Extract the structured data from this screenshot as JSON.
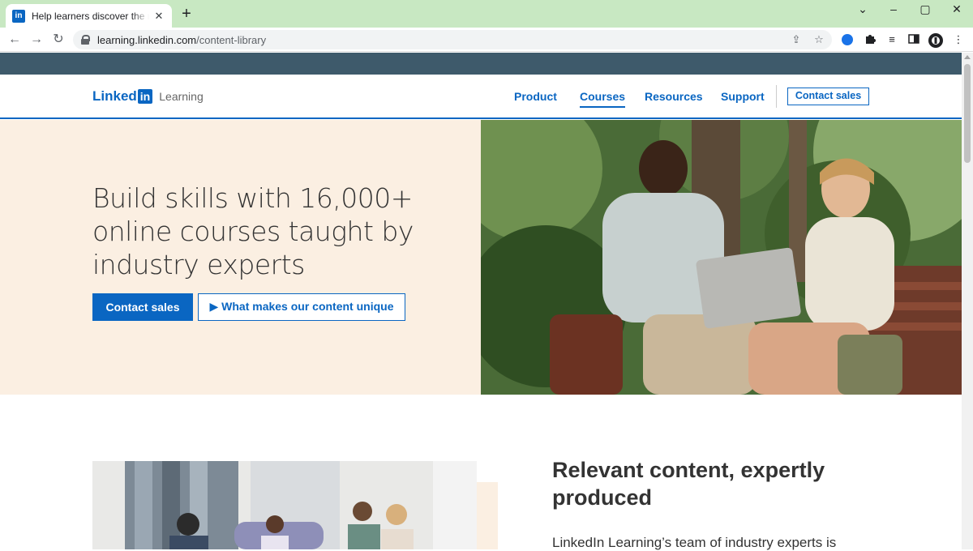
{
  "browser": {
    "tab_title": "Help learners discover the right c",
    "tab_favicon": "in",
    "url_host": "learning.linkedin.com",
    "url_path": "/content-library",
    "icons": [
      "back-icon",
      "forward-icon",
      "reload-icon",
      "lock-icon",
      "share-icon",
      "star-icon",
      "extension-icon",
      "puzzle-icon",
      "media-icon",
      "sidepanel-icon",
      "profile-icon",
      "menu-icon"
    ]
  },
  "header": {
    "logo_text": "Linked",
    "logo_in": "in",
    "logo_product": "Learning",
    "nav": [
      {
        "label": "Product"
      },
      {
        "label": "Courses"
      },
      {
        "label": "Resources"
      },
      {
        "label": "Support"
      }
    ],
    "cta": "Contact sales"
  },
  "hero": {
    "title": "Build skills with 16,000+ online courses taught by industry experts",
    "primary_button": "Contact sales",
    "secondary_button": "What makes our content unique"
  },
  "section": {
    "title": "Relevant content, expertly produced",
    "body": "LinkedIn Learning’s team of industry experts is"
  },
  "colors": {
    "brand_blue": "#0a66c2",
    "hero_bg": "#fbefe2",
    "top_strip": "#3e5a6b",
    "tabbar": "#c8e8c2"
  }
}
